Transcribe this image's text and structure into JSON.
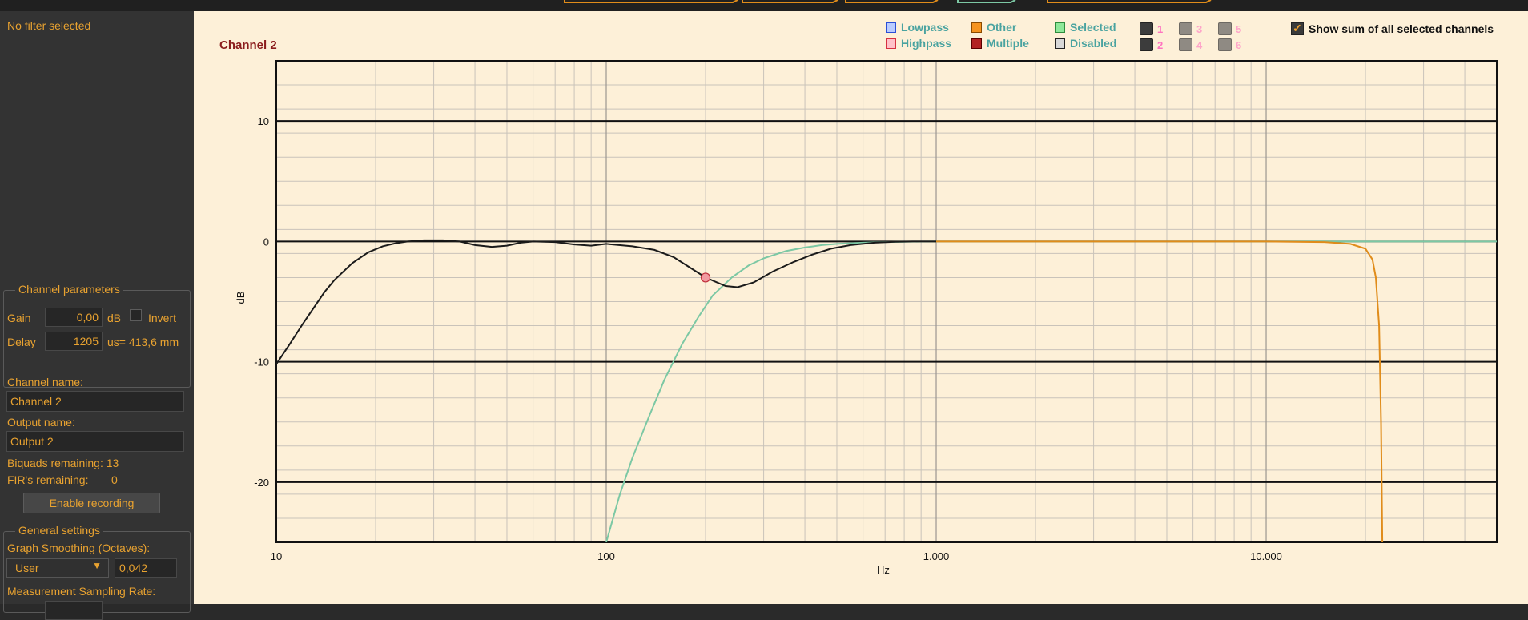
{
  "sidebar": {
    "filter_status": "No filter selected",
    "channel_params": {
      "legend": "Channel parameters",
      "gain_label": "Gain",
      "gain_value": "0,00",
      "gain_unit": "dB",
      "invert_label": "Invert",
      "delay_label": "Delay",
      "delay_value": "1205",
      "delay_unit": "us= 413,6 mm"
    },
    "channel_name_label": "Channel name:",
    "channel_name_value": "Channel 2",
    "output_name_label": "Output name:",
    "output_name_value": "Output 2",
    "biquads_remaining": "Biquads remaining: 13",
    "firs_label": "FIR's remaining:",
    "firs_value": "0",
    "enable_recording": "Enable recording",
    "general_settings": {
      "legend": "General settings",
      "smoothing_label": "Graph Smoothing (Octaves):",
      "smoothing_mode": "User",
      "smoothing_value": "0,042",
      "sampling_label": "Measurement Sampling Rate:"
    }
  },
  "graph": {
    "channel_title": "Channel 2",
    "legend": {
      "lowpass": "Lowpass",
      "highpass": "Highpass",
      "other": "Other",
      "multiple": "Multiple",
      "selected": "Selected",
      "disabled": "Disabled"
    },
    "channel_buttons": [
      "1",
      "2",
      "3",
      "4",
      "5",
      "6"
    ],
    "show_sum_label": "Show sum of all selected channels",
    "show_sum_checked": true
  },
  "colors": {
    "accent": "#e8a230",
    "panel_bg": "#333333",
    "graph_bg": "#fdf0d8",
    "sum_curve": "#1a1a1a",
    "selected_curve": "#7cc8a4",
    "other_curve": "#e08c1a",
    "filter_point": "#f29aa0",
    "legend_text": "#4aa3a0",
    "channel_number": "#ff73c0"
  },
  "chart_data": {
    "type": "line",
    "xlabel": "Hz",
    "ylabel": "dB",
    "xscale": "log",
    "xlim": [
      10,
      50000
    ],
    "ylim": [
      -25,
      15
    ],
    "x_ticks": [
      {
        "value": 10,
        "label": "10"
      },
      {
        "value": 100,
        "label": "100"
      },
      {
        "value": 1000,
        "label": "1.000"
      },
      {
        "value": 10000,
        "label": "10.000"
      }
    ],
    "y_ticks": [
      {
        "value": 10,
        "label": "10"
      },
      {
        "value": 0,
        "label": "0"
      },
      {
        "value": -10,
        "label": "-10"
      },
      {
        "value": -20,
        "label": "-20"
      }
    ],
    "grid": true,
    "series": [
      {
        "name": "Selected",
        "color": "#7cc8a4",
        "x": [
          100,
          110,
          120,
          135,
          150,
          170,
          190,
          210,
          240,
          270,
          300,
          350,
          400,
          450,
          500,
          600,
          700,
          800,
          900,
          1000,
          2000,
          5000,
          10000,
          20000,
          50000
        ],
        "y": [
          -25,
          -21,
          -18,
          -14.5,
          -11.5,
          -8.5,
          -6.3,
          -4.5,
          -3.0,
          -2.0,
          -1.4,
          -0.8,
          -0.5,
          -0.3,
          -0.2,
          -0.1,
          -0.05,
          -0.02,
          -0.01,
          0,
          0,
          0,
          0,
          0,
          0
        ]
      },
      {
        "name": "Other",
        "color": "#e08c1a",
        "x": [
          1000,
          5000,
          10000,
          15000,
          18000,
          20000,
          21000,
          21500,
          22000,
          22300,
          22500
        ],
        "y": [
          0,
          0,
          0,
          -0.05,
          -0.2,
          -0.6,
          -1.5,
          -3.0,
          -7.0,
          -15.0,
          -25
        ]
      },
      {
        "name": "Sum",
        "color": "#1a1a1a",
        "x": [
          10,
          11,
          12,
          13,
          14,
          15,
          17,
          19,
          21,
          23,
          25,
          28,
          32,
          36,
          40,
          45,
          50,
          55,
          60,
          70,
          80,
          90,
          100,
          120,
          140,
          160,
          180,
          200,
          230,
          250,
          280,
          320,
          370,
          420,
          480,
          550,
          650,
          750,
          850,
          1000
        ],
        "y": [
          -10.2,
          -8.5,
          -6.9,
          -5.5,
          -4.2,
          -3.2,
          -1.8,
          -0.9,
          -0.4,
          -0.15,
          0,
          0.1,
          0.1,
          0,
          -0.3,
          -0.45,
          -0.35,
          -0.1,
          0,
          -0.05,
          -0.25,
          -0.35,
          -0.2,
          -0.4,
          -0.7,
          -1.3,
          -2.2,
          -3.0,
          -3.7,
          -3.8,
          -3.4,
          -2.5,
          -1.7,
          -1.1,
          -0.6,
          -0.3,
          -0.1,
          -0.03,
          0,
          0
        ]
      }
    ],
    "markers": [
      {
        "series": "Highpass filter",
        "x": 200,
        "y": -3.0
      }
    ]
  }
}
